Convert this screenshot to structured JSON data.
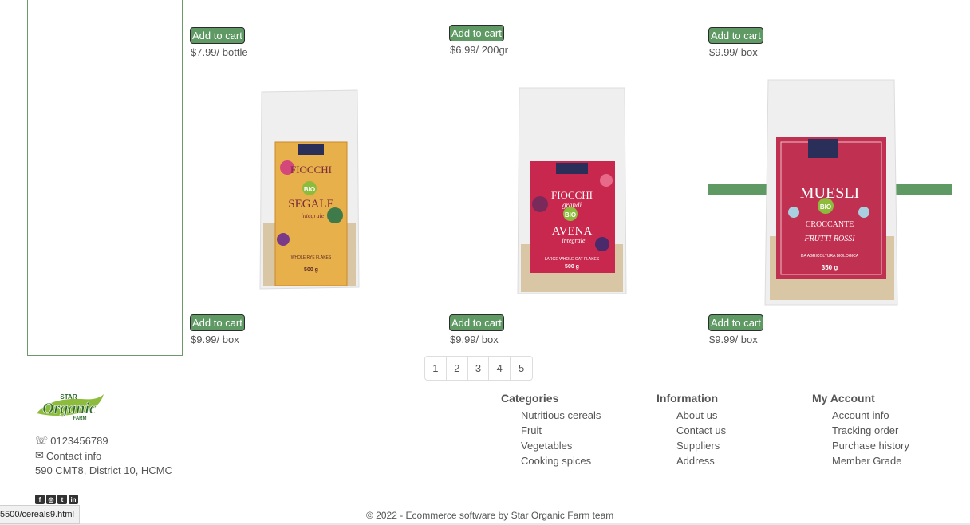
{
  "products_top": [
    {
      "cart_label": "Add to cart",
      "price": "$7.99/ bottle"
    },
    {
      "cart_label": "Add to cart",
      "price": "$6.99/ 200gr"
    },
    {
      "cart_label": "Add to cart",
      "price": "$9.99/ box"
    }
  ],
  "products_bottom": [
    {
      "name": "Fiocchi Segale Integrale",
      "cart_label": "Add to cart",
      "price": "$9.99/ box"
    },
    {
      "name": "Fiocchi grandi Avena Integrale",
      "cart_label": "Add to cart",
      "price": "$9.99/ box"
    },
    {
      "name": "Muesli Croccante ai Frutti Rossi",
      "cart_label": "Add to cart",
      "price": "$9.99/ box"
    }
  ],
  "pagination": [
    "1",
    "2",
    "3",
    "4",
    "5"
  ],
  "footer": {
    "logo": {
      "top": "STAR",
      "main": "Organic",
      "sub": "FARM"
    },
    "phone": "0123456789",
    "contact": "Contact info",
    "address": "590 CMT8, District 10, HCMC",
    "columns": [
      {
        "title": "Categories",
        "items": [
          "Nutritious cereals",
          "Fruit",
          "Vegetables",
          "Cooking spices"
        ]
      },
      {
        "title": "Information",
        "items": [
          "About us",
          "Contact us",
          "Suppliers",
          "Address"
        ]
      },
      {
        "title": "My Account",
        "items": [
          "Account info",
          "Tracking order",
          "Purchase history",
          "Member Grade"
        ]
      }
    ],
    "copyright": "© 2022 - Ecommerce software by Star Organic Farm team"
  },
  "status_url": "5500/cereals9.html",
  "colors": {
    "brand_green": "#5f9a64"
  }
}
